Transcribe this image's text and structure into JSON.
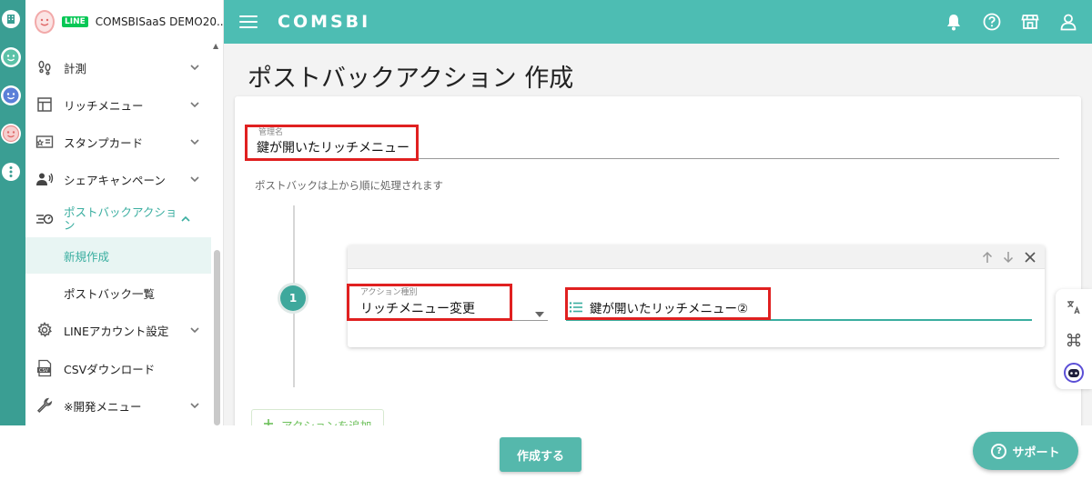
{
  "account": {
    "badge": "LINE",
    "name": "COMSBISaaS DEMO20..."
  },
  "header": {
    "logo": "COMSBI",
    "icons": [
      "bell-icon",
      "help-icon",
      "shop-icon",
      "user-icon"
    ]
  },
  "sidebar": {
    "items": [
      {
        "label": "計測",
        "icon": "footprint-icon"
      },
      {
        "label": "リッチメニュー",
        "icon": "layout-icon"
      },
      {
        "label": "スタンプカード",
        "icon": "stamp-card-icon"
      },
      {
        "label": "シェアキャンペーン",
        "icon": "share-icon"
      },
      {
        "label": "ポストバックアクション",
        "icon": "postback-icon"
      },
      {
        "label": "LINEアカウント設定",
        "icon": "gear-icon"
      },
      {
        "label": "CSVダウンロード",
        "icon": "csv-icon"
      },
      {
        "label": "※開発メニュー",
        "icon": "wrench-icon"
      }
    ],
    "subitems": [
      {
        "label": "新規作成"
      },
      {
        "label": "ポストバック一覧"
      }
    ]
  },
  "page": {
    "title": "ポストバックアクション 作成"
  },
  "form": {
    "name_label": "管理名",
    "name_value": "鍵が開いたリッチメニュー",
    "hint": "ポストバックは上から順に処理されます",
    "step_number": "1",
    "action_type_label": "アクション種別",
    "action_type_value": "リッチメニュー変更",
    "menu_value": "鍵が開いたリッチメニュー②",
    "add_action_label": "アクションを追加"
  },
  "footer": {
    "create_label": "作成する",
    "support_label": "サポート"
  },
  "colors": {
    "brand": "#4dbdb3",
    "accent": "#3aaea0",
    "highlight": "#e02020"
  }
}
